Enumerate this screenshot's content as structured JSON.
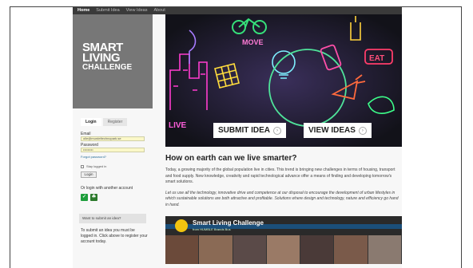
{
  "nav": {
    "items": [
      "Home",
      "Submit Idea",
      "View Ideas",
      "About"
    ],
    "active_index": 0
  },
  "logo": {
    "line1": "SMART",
    "line2": "LIVING",
    "line3": "CHALLENGE"
  },
  "login": {
    "tabs": [
      "Login",
      "Register"
    ],
    "active_tab": 0,
    "email_label": "Email",
    "email_value": "olle@murdeltechnopark.se",
    "password_label": "Password",
    "password_value": "•••••••••",
    "forgot_link": "Forgot password?",
    "remember_label": "Stay logged in",
    "login_button": "Login",
    "or_text": "Or login with another account"
  },
  "sidebar": {
    "submit_heading": "Want to submit an idea?",
    "submit_help": "To submit an idea you must be logged in. Click above to register your account today."
  },
  "hero": {
    "submit_button": "SUBMIT IDEA",
    "view_button": "VIEW IDEAS",
    "chevron": "›",
    "neon_labels": [
      "MOVE",
      "EAT",
      "LIVE"
    ]
  },
  "main": {
    "title": "How on earth can we live smarter?",
    "paragraph1": "Today, a growing majority of the global population live in cities. This trend is bringing new challenges in terms of housing, transport and food supply. New knowledge, creativity and rapid technological advance offer a means of finding and developing tomorrow's smart solutions.",
    "paragraph2": "Let us use all the technology, innovative drive and competence at our disposal to encourage the development of urban lifestyles in which sustainable solutions are both attractive and profitable. Solutions where design and technology, nature and efficiency go hand in hand."
  },
  "video": {
    "title": "Smart Living Challenge",
    "subtitle": "from HUMBLE Brands Bus"
  },
  "colors": {
    "nav_bg": "#3a3a3a",
    "logo_bg": "#777777",
    "input_bg": "#fbf8c8",
    "social_green": "#1e9e3c",
    "hero_bg": "#171722"
  },
  "icons": {
    "social1": "check-icon",
    "social2": "people-icon"
  }
}
